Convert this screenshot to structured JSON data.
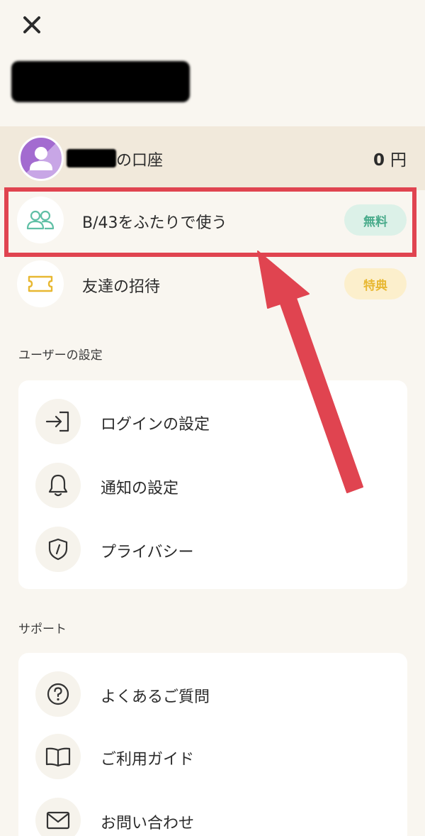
{
  "header": {
    "close_icon": "close-icon"
  },
  "account": {
    "label": "の口座",
    "amount": "0",
    "unit": "円"
  },
  "promos": [
    {
      "label": "B/43をふたりで使う",
      "badge": "無料",
      "icon": "two-people-icon",
      "badge_color": "#49ab8b"
    },
    {
      "label": "友達の招待",
      "badge": "特典",
      "icon": "ticket-icon",
      "badge_color": "#e8b832"
    }
  ],
  "sections": {
    "user_settings": {
      "title": "ユーザーの設定",
      "items": [
        {
          "label": "ログインの設定",
          "icon": "login-icon"
        },
        {
          "label": "通知の設定",
          "icon": "bell-icon"
        },
        {
          "label": "プライバシー",
          "icon": "shield-icon"
        }
      ]
    },
    "support": {
      "title": "サポート",
      "items": [
        {
          "label": "よくあるご質問",
          "icon": "question-icon"
        },
        {
          "label": "ご利用ガイド",
          "icon": "book-icon"
        },
        {
          "label": "お問い合わせ",
          "icon": "mail-icon"
        }
      ]
    }
  },
  "colors": {
    "background": "#f9f6f0",
    "account_row": "#f1e9db",
    "highlight": "#e04450",
    "avatar": "#a36bd0"
  }
}
